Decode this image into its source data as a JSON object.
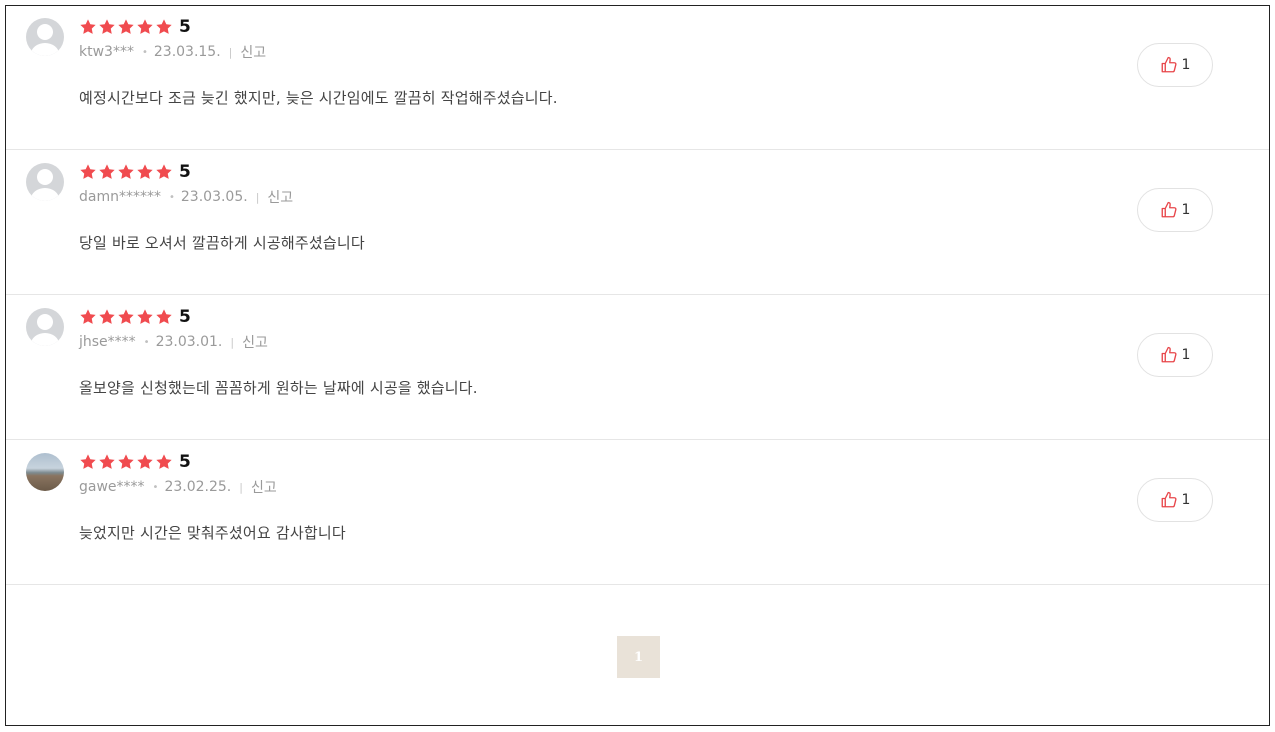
{
  "theme": {
    "star_color": "#f04b4f",
    "like_icon_color": "#e8464a",
    "pager_bg": "#e9e2d8"
  },
  "reviews": [
    {
      "rating": "5",
      "stars": 5,
      "user": "ktw3***",
      "date": "23.03.15.",
      "report_label": "신고",
      "content": "예정시간보다 조금 늦긴 했지만, 늦은 시간임에도 깔끔히 작업해주셨습니다.",
      "likes": "1",
      "avatar": "default-avatar-icon"
    },
    {
      "rating": "5",
      "stars": 5,
      "user": "damn******",
      "date": "23.03.05.",
      "report_label": "신고",
      "content": "당일 바로 오셔서 깔끔하게 시공해주셨습니다",
      "likes": "1",
      "avatar": "default-avatar-icon"
    },
    {
      "rating": "5",
      "stars": 5,
      "user": "jhse****",
      "date": "23.03.01.",
      "report_label": "신고",
      "content": "올보양을 신청했는데 꼼꼼하게 원하는 날짜에 시공을 했습니다.",
      "likes": "1",
      "avatar": "default-avatar-icon"
    },
    {
      "rating": "5",
      "stars": 5,
      "user": "gawe****",
      "date": "23.02.25.",
      "report_label": "신고",
      "content": "늦었지만 시간은 맞춰주셨어요 감사합니다",
      "likes": "1",
      "avatar": "beach-photo-avatar"
    }
  ],
  "pagination": {
    "current_page": "1"
  }
}
